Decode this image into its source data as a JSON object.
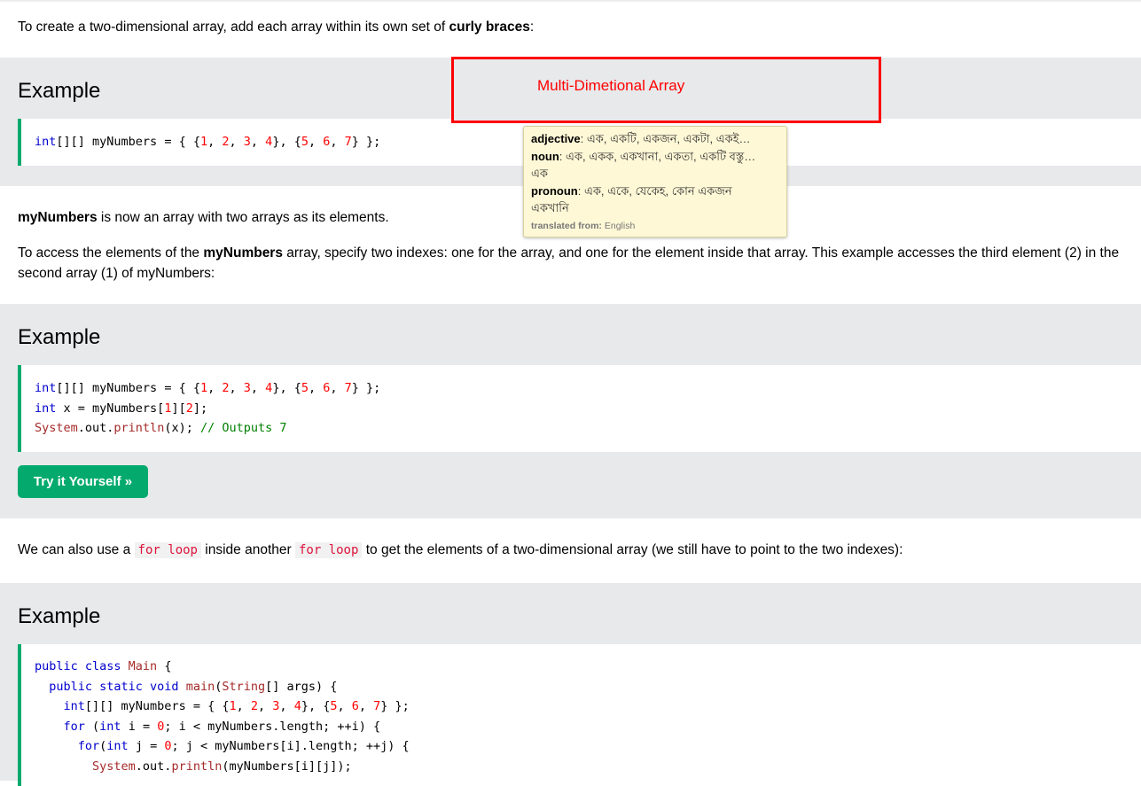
{
  "intro": {
    "p1_pre": "To create a two-dimensional array, add each array within its own set of ",
    "p1_bold": "curly braces",
    "p1_post": ":"
  },
  "examples": [
    {
      "title": "Example",
      "code": [
        [
          [
            "int",
            "kw"
          ],
          [
            "[][] myNumbers ",
            "op"
          ],
          [
            "= { {",
            "op"
          ],
          [
            "1",
            "num"
          ],
          [
            ", ",
            "op"
          ],
          [
            "2",
            "num"
          ],
          [
            ", ",
            "op"
          ],
          [
            "3",
            "num"
          ],
          [
            ", ",
            "op"
          ],
          [
            "4",
            "num"
          ],
          [
            "}, {",
            "op"
          ],
          [
            "5",
            "num"
          ],
          [
            ", ",
            "op"
          ],
          [
            "6",
            "num"
          ],
          [
            ", ",
            "op"
          ],
          [
            "7",
            "num"
          ],
          [
            "} };",
            "op"
          ]
        ]
      ]
    },
    {
      "title": "Example",
      "code": [
        [
          [
            "int",
            "kw"
          ],
          [
            "[][] myNumbers ",
            "op"
          ],
          [
            "= { {",
            "op"
          ],
          [
            "1",
            "num"
          ],
          [
            ", ",
            "op"
          ],
          [
            "2",
            "num"
          ],
          [
            ", ",
            "op"
          ],
          [
            "3",
            "num"
          ],
          [
            ", ",
            "op"
          ],
          [
            "4",
            "num"
          ],
          [
            "}, {",
            "op"
          ],
          [
            "5",
            "num"
          ],
          [
            ", ",
            "op"
          ],
          [
            "6",
            "num"
          ],
          [
            ", ",
            "op"
          ],
          [
            "7",
            "num"
          ],
          [
            "} };",
            "op"
          ]
        ],
        [
          [
            "int",
            "kw"
          ],
          [
            " x = myNumbers[",
            "op"
          ],
          [
            "1",
            "num"
          ],
          [
            "][",
            "op"
          ],
          [
            "2",
            "num"
          ],
          [
            "];",
            "op"
          ]
        ],
        [
          [
            "System",
            "cl"
          ],
          [
            ".out.",
            "op"
          ],
          [
            "println",
            "fn"
          ],
          [
            "(x); ",
            "op"
          ],
          [
            "// Outputs 7",
            "cm"
          ]
        ]
      ],
      "button": "Try it Yourself »"
    },
    {
      "title": "Example",
      "code": [
        [
          [
            "public class ",
            "kw"
          ],
          [
            "Main",
            "cl"
          ],
          [
            " {",
            "op"
          ]
        ],
        [
          [
            "  public static void ",
            "kw"
          ],
          [
            "main",
            "fn"
          ],
          [
            "(",
            "op"
          ],
          [
            "String",
            "cl"
          ],
          [
            "[] args) {",
            "op"
          ]
        ],
        [
          [
            "    int",
            "kw"
          ],
          [
            "[][] myNumbers = { {",
            "op"
          ],
          [
            "1",
            "num"
          ],
          [
            ", ",
            "op"
          ],
          [
            "2",
            "num"
          ],
          [
            ", ",
            "op"
          ],
          [
            "3",
            "num"
          ],
          [
            ", ",
            "op"
          ],
          [
            "4",
            "num"
          ],
          [
            "}, {",
            "op"
          ],
          [
            "5",
            "num"
          ],
          [
            ", ",
            "op"
          ],
          [
            "6",
            "num"
          ],
          [
            ", ",
            "op"
          ],
          [
            "7",
            "num"
          ],
          [
            "} };",
            "op"
          ]
        ],
        [
          [
            "    for",
            "kw"
          ],
          [
            " (",
            "op"
          ],
          [
            "int",
            "kw"
          ],
          [
            " i = ",
            "op"
          ],
          [
            "0",
            "num"
          ],
          [
            "; i < myNumbers.length; ++i) {",
            "op"
          ]
        ],
        [
          [
            "      for",
            "kw"
          ],
          [
            "(",
            "op"
          ],
          [
            "int",
            "kw"
          ],
          [
            " j = ",
            "op"
          ],
          [
            "0",
            "num"
          ],
          [
            "; j < myNumbers[i].length; ++j) {",
            "op"
          ]
        ],
        [
          [
            "        System",
            "cl"
          ],
          [
            ".out.",
            "op"
          ],
          [
            "println",
            "fn"
          ],
          [
            "(myNumbers[i][j]);",
            "op"
          ]
        ]
      ]
    }
  ],
  "para2": {
    "bold": "myNumbers",
    "rest": " is now an array with two arrays as its elements."
  },
  "para3": {
    "pre": "To access the elements of the ",
    "bold": "myNumbers",
    "post": " array, specify two indexes: one for the array, and one for the element inside that array. This example accesses the third element (2) in the second array (1) of myNumbers:"
  },
  "para4": {
    "pre": "We can also use a ",
    "code1": "for loop",
    "mid": " inside another ",
    "code2": "for loop",
    "post": " to get the elements of a two-dimensional array (we still have to point to the two indexes):"
  },
  "annotation": {
    "label": "Multi-Dimetional Array",
    "color": "#ff0000"
  },
  "translation_tooltip": {
    "rows": [
      {
        "pos": "adjective",
        "text": ": এক, একটি, একজন, একটা, একই…"
      },
      {
        "pos": "noun",
        "text": ": এক, একক, একখানা, একতা, একটি বস্তু…"
      },
      {
        "pos": "",
        "text": "এক"
      },
      {
        "pos": "pronoun",
        "text": ": এক, একে, যেকেহ, কোন একজন"
      },
      {
        "pos": "",
        "text": "একখানি"
      }
    ],
    "source_label": "translated from:",
    "source_lang": "English"
  },
  "colors": {
    "accent_green": "#04aa6d",
    "example_bg": "#e7e9eb",
    "tooltip_bg": "#fff8d6"
  }
}
